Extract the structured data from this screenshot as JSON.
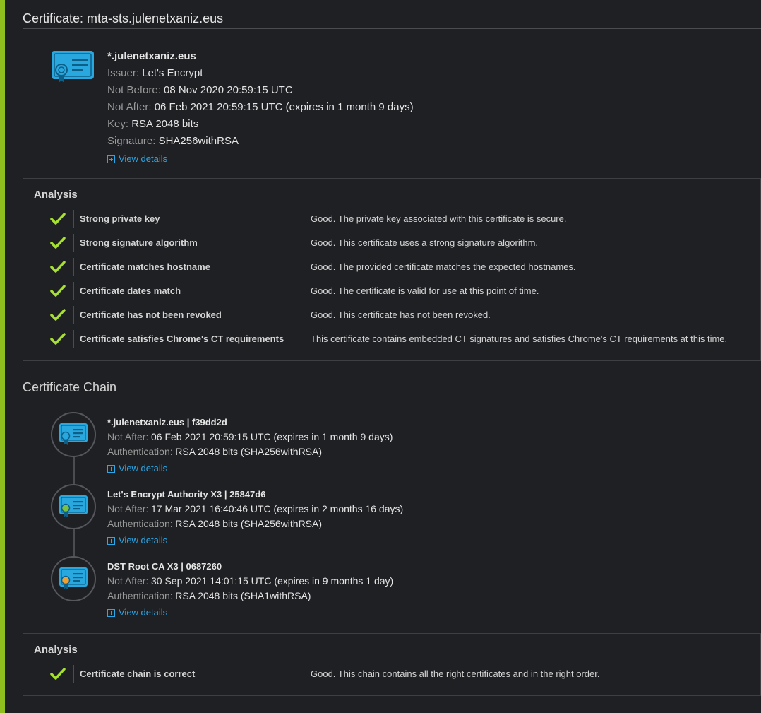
{
  "certificate": {
    "title": "Certificate: mta-sts.julenetxaniz.eus",
    "name": "*.julenetxaniz.eus",
    "issuer_label": "Issuer:",
    "issuer": "Let's Encrypt",
    "not_before_label": "Not Before:",
    "not_before": "08 Nov 2020 20:59:15 UTC",
    "not_after_label": "Not After:",
    "not_after": "06 Feb 2021 20:59:15 UTC (expires in 1 month 9 days)",
    "key_label": "Key:",
    "key": "RSA 2048 bits",
    "signature_label": "Signature:",
    "signature": "SHA256withRSA",
    "view_details": "View details",
    "icon_color": "#29a8e0"
  },
  "analysis": {
    "title": "Analysis",
    "rows": [
      {
        "name": "Strong private key",
        "desc": "Good. The private key associated with this certificate is secure."
      },
      {
        "name": "Strong signature algorithm",
        "desc": "Good. This certificate uses a strong signature algorithm."
      },
      {
        "name": "Certificate matches hostname",
        "desc": "Good. The provided certificate matches the expected hostnames."
      },
      {
        "name": "Certificate dates match",
        "desc": "Good. The certificate is valid for use at this point of time."
      },
      {
        "name": "Certificate has not been revoked",
        "desc": "Good. This certificate has not been revoked."
      },
      {
        "name": "Certificate satisfies Chrome's CT requirements",
        "desc": "This certificate contains embedded CT signatures and satisfies Chrome's CT requirements at this time."
      }
    ],
    "check_color": "#a6e22e"
  },
  "chain": {
    "title": "Certificate Chain",
    "items": [
      {
        "name": "*.julenetxaniz.eus | f39dd2d",
        "not_after_label": "Not After:",
        "not_after": "06 Feb 2021 20:59:15 UTC (expires in 1 month 9 days)",
        "auth_label": "Authentication:",
        "auth": "RSA 2048 bits (SHA256withRSA)",
        "view_details": "View details",
        "seal_color": "#29a8e0"
      },
      {
        "name": "Let's Encrypt Authority X3 | 25847d6",
        "not_after_label": "Not After:",
        "not_after": "17 Mar 2021 16:40:46 UTC (expires in 2 months 16 days)",
        "auth_label": "Authentication:",
        "auth": "RSA 2048 bits (SHA256withRSA)",
        "view_details": "View details",
        "seal_color": "#7ac143"
      },
      {
        "name": "DST Root CA X3 | 0687260",
        "not_after_label": "Not After:",
        "not_after": "30 Sep 2021 14:01:15 UTC (expires in 9 months 1 day)",
        "auth_label": "Authentication:",
        "auth": "RSA 2048 bits (SHA1withRSA)",
        "view_details": "View details",
        "seal_color": "#f0a030"
      }
    ]
  },
  "chain_analysis": {
    "title": "Analysis",
    "rows": [
      {
        "name": "Certificate chain is correct",
        "desc": "Good. This chain contains all the right certificates and in the right order."
      }
    ]
  },
  "colors": {
    "accent": "#8fbf1f",
    "link": "#2aa7e8",
    "background": "#1f2023"
  }
}
